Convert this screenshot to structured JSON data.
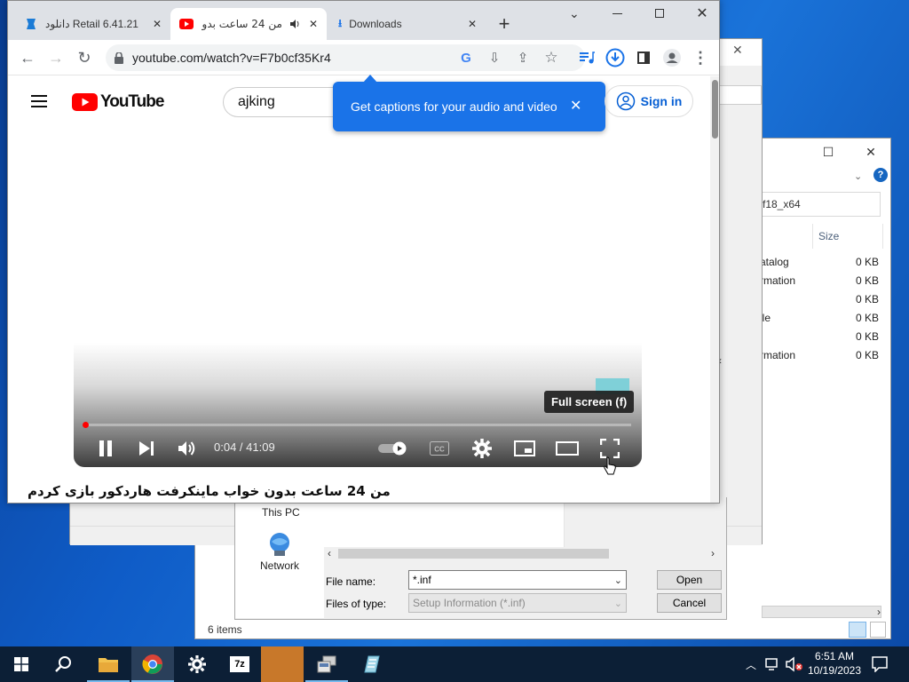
{
  "chrome": {
    "tabs": [
      {
        "label": "دانلود Retail 6.41.21",
        "close": "✕"
      },
      {
        "label": "من 24 ساعت بدو",
        "close": "✕"
      },
      {
        "label": "Downloads",
        "close": "✕"
      }
    ],
    "new_tab": "+",
    "url": "youtube.com/watch?v=F7b0cf35Kr4"
  },
  "youtube": {
    "logo_text": "YouTube",
    "search_value": "ajking",
    "captions_bubble": "Get captions for your audio and video",
    "sign_in": "Sign in",
    "player": {
      "time": "0:04 / 41:09",
      "tooltip": "Full screen (f)",
      "progress_fraction": 0.002
    },
    "video_title": "من 24 ساعت بدون خواب ماینکرفت هاردکور بازی کردم"
  },
  "dialog": {
    "nav_items": [
      "This PC",
      "Network"
    ],
    "file_name_label": "File name:",
    "file_name_value": "*.inf",
    "files_of_type_label": "Files of type:",
    "files_of_type_value": "Setup Information (*.inf)",
    "open_button": "Open",
    "cancel_button": "Cancel"
  },
  "explorer": {
    "path_fragment": "f18_x64",
    "size_header": "Size",
    "rows": [
      {
        "name": "atalog",
        "size": "0 KB"
      },
      {
        "name": "rmation",
        "size": "0 KB"
      },
      {
        "name": "",
        "size": "0 KB"
      },
      {
        "name": "ile",
        "size": "0 KB"
      },
      {
        "name": "",
        "size": "0 KB"
      },
      {
        "name": "rmation",
        "size": "0 KB"
      }
    ],
    "status": "6 items"
  },
  "taskbar": {
    "time": "6:51 AM",
    "date": "10/19/2023"
  }
}
